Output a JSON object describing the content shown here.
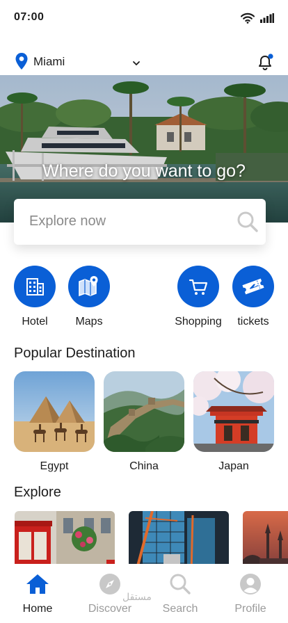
{
  "status": {
    "time": "07:00",
    "icons": [
      "wifi-icon",
      "signal-icon"
    ]
  },
  "location": {
    "city": "Miami",
    "icon": "location-pin-icon"
  },
  "hero": {
    "title": "Where do you want to go?"
  },
  "search": {
    "placeholder": "Explore now",
    "icon": "search-icon"
  },
  "categories": [
    {
      "label": "Hotel",
      "icon": "hotel-icon"
    },
    {
      "label": "Maps",
      "icon": "map-icon"
    },
    {
      "label": "Shopping",
      "icon": "cart-icon"
    },
    {
      "label": "tickets",
      "icon": "ticket-icon"
    }
  ],
  "popular": {
    "title": "Popular Destination",
    "items": [
      {
        "label": "Egypt"
      },
      {
        "label": "China"
      },
      {
        "label": "Japan"
      }
    ]
  },
  "explore": {
    "title": "Explore"
  },
  "nav": [
    {
      "label": "Home",
      "icon": "home-icon",
      "active": true
    },
    {
      "label": "Discover",
      "icon": "compass-icon",
      "active": false
    },
    {
      "label": "Search",
      "icon": "search-icon",
      "active": false
    },
    {
      "label": "Profile",
      "icon": "profile-icon",
      "active": false
    }
  ],
  "watermark": "مستقل",
  "colors": {
    "accent": "#0a5fd6",
    "notification_dot": "#0a5fd6",
    "inactive": "#9a9a9a"
  }
}
